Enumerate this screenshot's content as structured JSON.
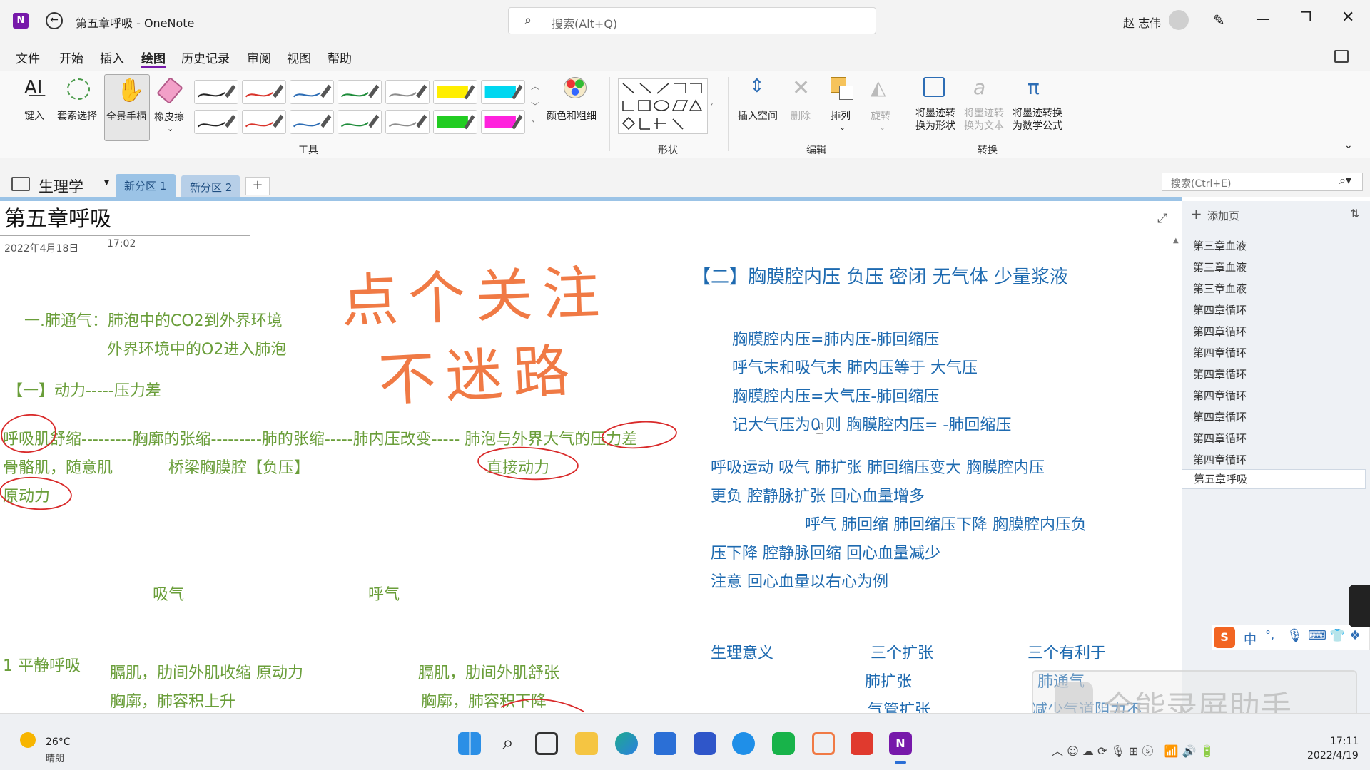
{
  "window": {
    "title": "第五章呼吸 - OneNote",
    "app_icon": "onenote-icon",
    "search_placeholder": "搜索(Alt+Q)",
    "user": "赵 志伟"
  },
  "menu": [
    "文件",
    "开始",
    "插入",
    "绘图",
    "历史记录",
    "审阅",
    "视图",
    "帮助"
  ],
  "menu_active": "绘图",
  "ribbon": {
    "tools": {
      "type": "键入",
      "lasso": "套索选择",
      "panning": "全景手柄",
      "eraser": "橡皮擦",
      "color_thickness": "颜色和粗细",
      "group": "工具"
    },
    "shapes_group": "形状",
    "edit": {
      "insert_space": "插入空间",
      "delete": "删除",
      "arrange": "排列",
      "rotate": "旋转",
      "group": "编辑"
    },
    "convert": {
      "ink_to_shape": "将墨迹转换为形状",
      "ink_to_text": "将墨迹转换为文本",
      "ink_to_math": "将墨迹转换为数学公式",
      "group": "转换"
    },
    "pen_colors_row1": [
      "#222222",
      "#d9342b",
      "#2d6db5",
      "#1e8c3a",
      "#8c8c8c",
      "#ffee00",
      "#00d7f0"
    ],
    "pen_colors_row2": [
      "#222222",
      "#d9342b",
      "#2d6db5",
      "#1e8c3a",
      "#8c8c8c",
      "#22cc22",
      "#ff22dd"
    ]
  },
  "notebook": {
    "name": "生理学",
    "sections": [
      "新分区 1",
      "新分区 2"
    ],
    "add": "+",
    "search_placeholder": "搜索(Ctrl+E)"
  },
  "page": {
    "title": "第五章呼吸",
    "date": "2022年4月18日",
    "time": "17:02",
    "ink_line1": "点个关注",
    "ink_line2": "不迷路",
    "left": {
      "l1": "一.肺通气：肺泡中的CO2到外界环境",
      "l2": "外界环境中的O2进入肺泡",
      "l3": "【一】动力-----压力差",
      "l4": "呼吸肌舒缩---------胸廓的张缩---------肺的张缩-----肺内压改变----- 肺泡与外界大气的压力差",
      "l5a": "骨骼肌，随意肌",
      "l5b": "桥梁胸膜腔【负压】",
      "l5c": "直接动力",
      "l6": "原动力",
      "inhale": "吸气",
      "exhale": "呼气",
      "quiet": "1 平静呼吸",
      "q1a": "膈肌，肋间外肌收缩  原动力",
      "q1b": "膈肌，肋间外肌舒张",
      "q2a": "胸廓，肺容积上升",
      "q2b": "胸廓，肺容积下降"
    },
    "right": {
      "heading": "【二】胸膜腔内压 负压  密闭  无气体 少量浆液",
      "r1": "胸膜腔内压=肺内压-肺回缩压",
      "r2": "呼气末和吸气末   肺内压等于 大气压",
      "r3": "胸膜腔内压=大气压-肺回缩压",
      "r4": "记大气压为0 则  胸膜腔内压=    -肺回缩压",
      "r5": "呼吸运动       吸气    肺扩张    肺回缩压变大  胸膜腔内压",
      "r6": "更负  腔静脉扩张   回心血量增多",
      "r7": "呼气     肺回缩   肺回缩压下降   胸膜腔内压负",
      "r8": "压下降   腔静脉回缩    回心血量减少",
      "r9": "注意   回心血量以右心为例",
      "s1": "生理意义",
      "s2": "三个扩张",
      "s3": "三个有利于",
      "s4": "肺扩张",
      "s5": "肺通气",
      "s6": "气管扩张",
      "s7": "减少气道阻力不"
    }
  },
  "pages_panel": {
    "add_page": "添加页",
    "items": [
      "第三章血液",
      "第三章血液",
      "第三章血液",
      "第四章循环",
      "第四章循环",
      "第四章循环",
      "第四章循环",
      "第四章循环",
      "第四章循环",
      "第四章循环",
      "第四章循环",
      "第五章呼吸"
    ],
    "selected_index": 11
  },
  "watermark": "全能录屏助手",
  "ime": {
    "lang": "中"
  },
  "taskbar": {
    "weather_temp": "26°C",
    "weather_desc": "晴朗",
    "clock_time": "17:11",
    "clock_date": "2022/4/19",
    "apps": [
      "start-icon",
      "search-icon",
      "task-view-icon",
      "file-explorer-icon",
      "edge-icon",
      "store-icon",
      "app-icon",
      "browser-icon",
      "wechat-icon",
      "snip-icon",
      "recorder-icon",
      "onenote-taskbar-icon"
    ]
  }
}
